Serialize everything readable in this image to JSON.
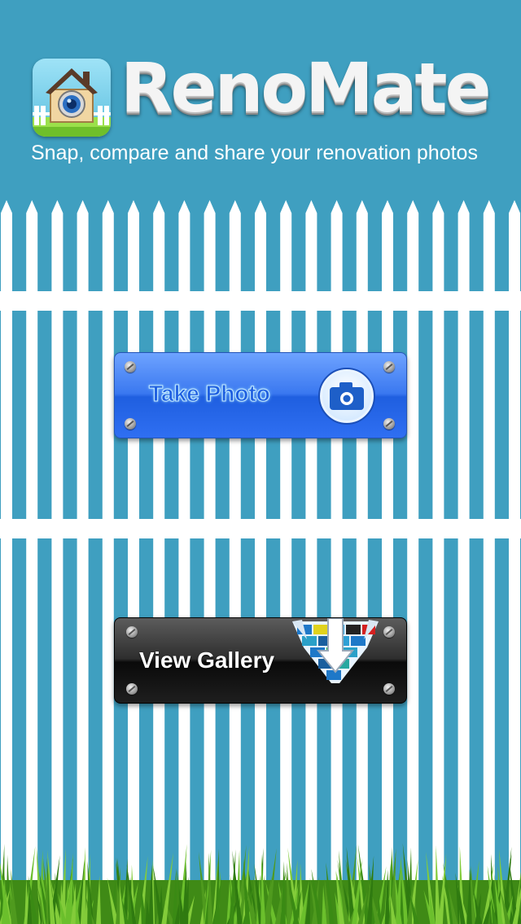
{
  "app": {
    "title": "RenoMate",
    "tagline": "Snap, compare and share your renovation photos"
  },
  "buttons": {
    "take_photo": "Take Photo",
    "view_gallery": "View Gallery"
  },
  "icons": {
    "app_icon": "house-camera-icon",
    "take_photo": "camera-icon",
    "view_gallery": "gallery-download-icon"
  },
  "colors": {
    "background": "#3f9fc0",
    "fence": "#ffffff",
    "take_photo_button": "#2f6ff2",
    "view_gallery_button": "#1e1e1e",
    "grass": "#4f9a1e"
  }
}
